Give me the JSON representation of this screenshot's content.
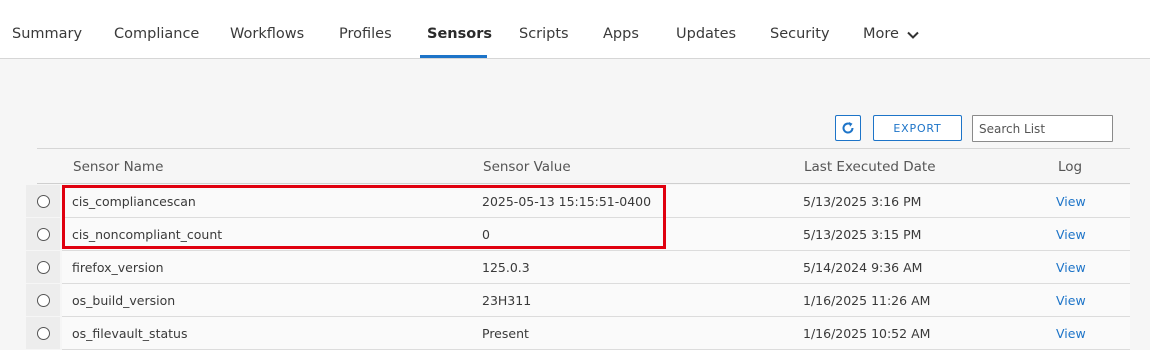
{
  "tabs": [
    {
      "label": "Summary"
    },
    {
      "label": "Compliance"
    },
    {
      "label": "Workflows"
    },
    {
      "label": "Profiles"
    },
    {
      "label": "Sensors",
      "active": true
    },
    {
      "label": "Scripts"
    },
    {
      "label": "Apps"
    },
    {
      "label": "Updates"
    },
    {
      "label": "Security"
    },
    {
      "label": "More"
    }
  ],
  "toolbar": {
    "refresh_icon": "refresh-icon",
    "export_label": "EXPORT",
    "search_placeholder": "Search List"
  },
  "table": {
    "columns": [
      "Sensor Name",
      "Sensor Value",
      "Last Executed Date",
      "Log"
    ],
    "rows": [
      {
        "name": "cis_compliancescan",
        "value": "2025-05-13 15:15:51-0400",
        "date": "5/13/2025 3:16 PM",
        "log": "View"
      },
      {
        "name": "cis_noncompliant_count",
        "value": "0",
        "date": "5/13/2025 3:15 PM",
        "log": "View"
      },
      {
        "name": "firefox_version",
        "value": "125.0.3",
        "date": "5/14/2024 9:36 AM",
        "log": "View"
      },
      {
        "name": "os_build_version",
        "value": "23H311",
        "date": "1/16/2025 11:26 AM",
        "log": "View"
      },
      {
        "name": "os_filevault_status",
        "value": "Present",
        "date": "1/16/2025 10:52 AM",
        "log": "View"
      }
    ]
  },
  "colors": {
    "accent": "#1d74c8",
    "highlight": "#e0000f"
  }
}
